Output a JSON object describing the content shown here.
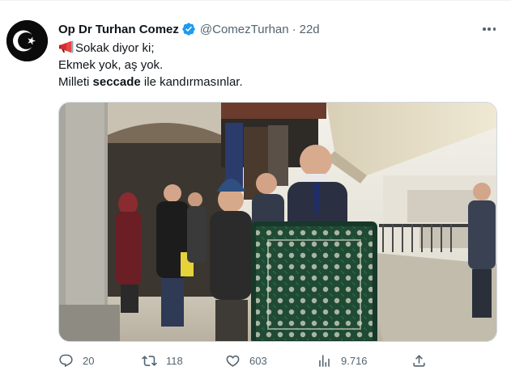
{
  "tweet": {
    "author": {
      "display_name": "Op Dr Turhan Comez",
      "handle": "@ComezTurhan",
      "verified": true,
      "avatar_icon": "crescent-star-flag-icon"
    },
    "separator": "·",
    "time": "22d",
    "text": {
      "line1": "Sokak diyor ki;",
      "line2": "Ekmek yok, aş yok.",
      "line3_before": "Milleti ",
      "line3_bold": "seccade",
      "line3_after": " ile kandırmasınlar."
    },
    "media": {
      "type": "photo",
      "description_icon": "street-scene-photo"
    },
    "actions": {
      "replies": "20",
      "retweets": "118",
      "likes": "603",
      "views": "9.716"
    }
  },
  "colors": {
    "text_primary": "#0f1419",
    "text_secondary": "#536471",
    "verified_blue": "#1d9bf0",
    "border": "#cfd9de"
  }
}
